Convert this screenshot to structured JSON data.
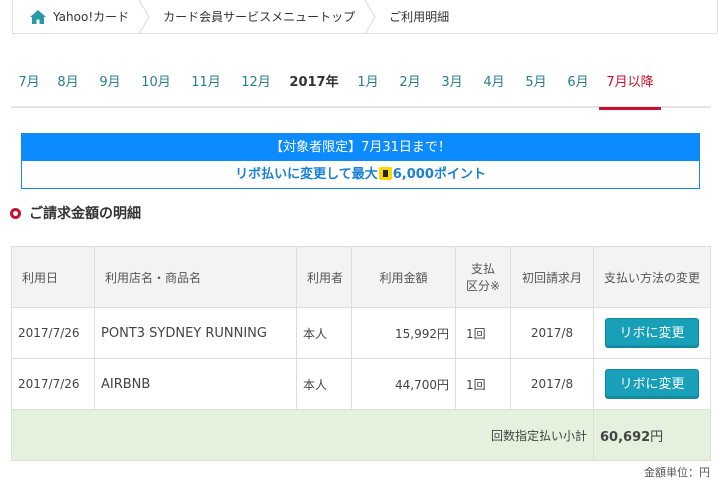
{
  "breadcrumb": {
    "home": "Yahoo!カード",
    "member_top": "カード会員サービスメニュートップ",
    "current": "ご利用明細",
    "home_icon": "home-icon"
  },
  "tabs": [
    {
      "label": "7月",
      "type": "month"
    },
    {
      "label": "8月",
      "type": "month"
    },
    {
      "label": "9月",
      "type": "month"
    },
    {
      "label": "10月",
      "type": "month"
    },
    {
      "label": "11月",
      "type": "month"
    },
    {
      "label": "12月",
      "type": "month"
    },
    {
      "label": "2017年",
      "type": "year"
    },
    {
      "label": "1月",
      "type": "month"
    },
    {
      "label": "2月",
      "type": "month"
    },
    {
      "label": "3月",
      "type": "month"
    },
    {
      "label": "4月",
      "type": "month"
    },
    {
      "label": "5月",
      "type": "month"
    },
    {
      "label": "6月",
      "type": "month"
    },
    {
      "label": "7月以降",
      "type": "active"
    }
  ],
  "banner": {
    "top": "【対象者限定】7月31日まで！",
    "bottom_prefix": "リボ払いに変更して最大",
    "bottom_suffix": "6,000ポイント",
    "colors": {
      "top_bg": "#0c8bff",
      "text": "#1a7fd8"
    }
  },
  "section": {
    "title": "ご請求金額の明細"
  },
  "table": {
    "headers": {
      "date": "利用日",
      "store": "利用店名・商品名",
      "user": "利用者",
      "amount": "利用金額",
      "payment_1": "支払",
      "payment_2": "区分※",
      "first_bill": "初回請求月",
      "change": "支払い方法の変更"
    },
    "rows": [
      {
        "date": "2017/7/26",
        "store": "PONT3 SYDNEY RUNNING",
        "user": "本人",
        "amount": "15,992円",
        "payment": "1回",
        "first_bill": "2017/8",
        "button": "リボに変更"
      },
      {
        "date": "2017/7/26",
        "store": "AIRBNB",
        "user": "本人",
        "amount": "44,700円",
        "payment": "1回",
        "first_bill": "2017/8",
        "button": "リボに変更"
      }
    ],
    "subtotal": {
      "label": "回数指定払い小計",
      "value": "60,692",
      "yen": "円"
    }
  },
  "unit_note": "金額単位：円",
  "colors": {
    "accent": "#c8102e",
    "link": "#2a7f8a",
    "button": "#17a0b8",
    "subtotal_bg": "#e3f1dd"
  }
}
